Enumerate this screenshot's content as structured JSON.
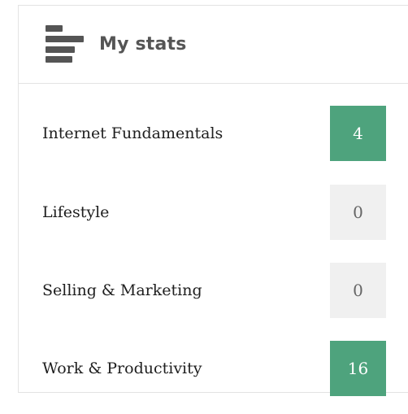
{
  "header": {
    "title": "My stats",
    "icon": "bar-chart-icon"
  },
  "colors": {
    "active_badge": "#4ea37d",
    "empty_badge": "#f0f0f0",
    "border": "#e3e3e3",
    "header_text": "#555555"
  },
  "stats": [
    {
      "label": "Internet Fundamentals",
      "count": "4",
      "state": "active"
    },
    {
      "label": "Lifestyle",
      "count": "0",
      "state": "empty"
    },
    {
      "label": "Selling & Marketing",
      "count": "0",
      "state": "empty"
    },
    {
      "label": "Work & Productivity",
      "count": "16",
      "state": "active"
    }
  ]
}
